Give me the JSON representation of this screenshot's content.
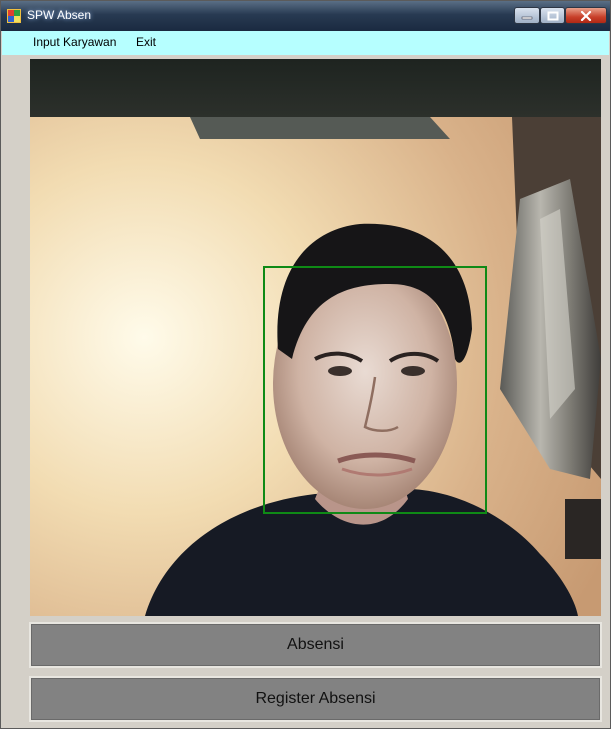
{
  "window": {
    "title": "SPW Absen"
  },
  "menu": {
    "items": [
      "Input Karyawan",
      "Exit"
    ]
  },
  "buttons": {
    "absensi": "Absensi",
    "register": "Register Absensi"
  },
  "colors": {
    "menubar": "#b6ffff",
    "detection_box": "#0f8a16",
    "button_bg": "#828282"
  },
  "icons": [
    "app-icon",
    "minimize-icon",
    "maximize-icon",
    "close-icon"
  ]
}
